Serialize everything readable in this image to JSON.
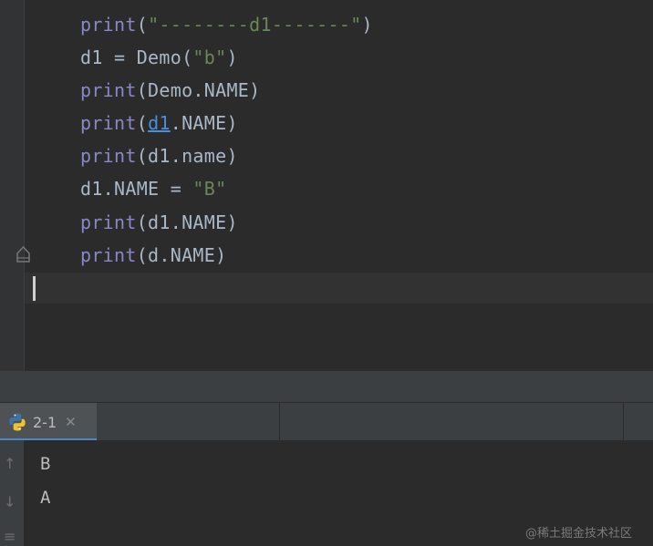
{
  "editor": {
    "partial_top_line": "print( ... )",
    "lines": [
      {
        "kw": "print",
        "open": "(",
        "str": "\"--------d1-------\"",
        "close": ")"
      },
      {
        "plain": "d1 = Demo(",
        "str": "\"b\"",
        "close": ")"
      },
      {
        "kw": "print",
        "plain": "(Demo.NAME)"
      },
      {
        "kw": "print",
        "open": "(",
        "ref": "d1",
        "rest": ".NAME)"
      },
      {
        "kw": "print",
        "plain": "(d1.name)"
      },
      {
        "plain": "d1.NAME = ",
        "str": "\"B\""
      },
      {
        "kw": "print",
        "plain": "(d1.NAME)"
      },
      {
        "kw": "print",
        "plain": "(d.NAME)"
      }
    ]
  },
  "run_panel": {
    "tab_label": "2-1",
    "tab_icon": "python-icon",
    "close_symbol": "✕"
  },
  "console": {
    "output": [
      "B",
      "A"
    ]
  },
  "watermark": "@稀土掘金技术社区",
  "colors": {
    "background": "#2b2b2b",
    "keyword": "#8888c6",
    "string": "#6a8759",
    "text": "#a9b7c6",
    "link": "#4a8edc",
    "tab_active": "#4e5254"
  }
}
